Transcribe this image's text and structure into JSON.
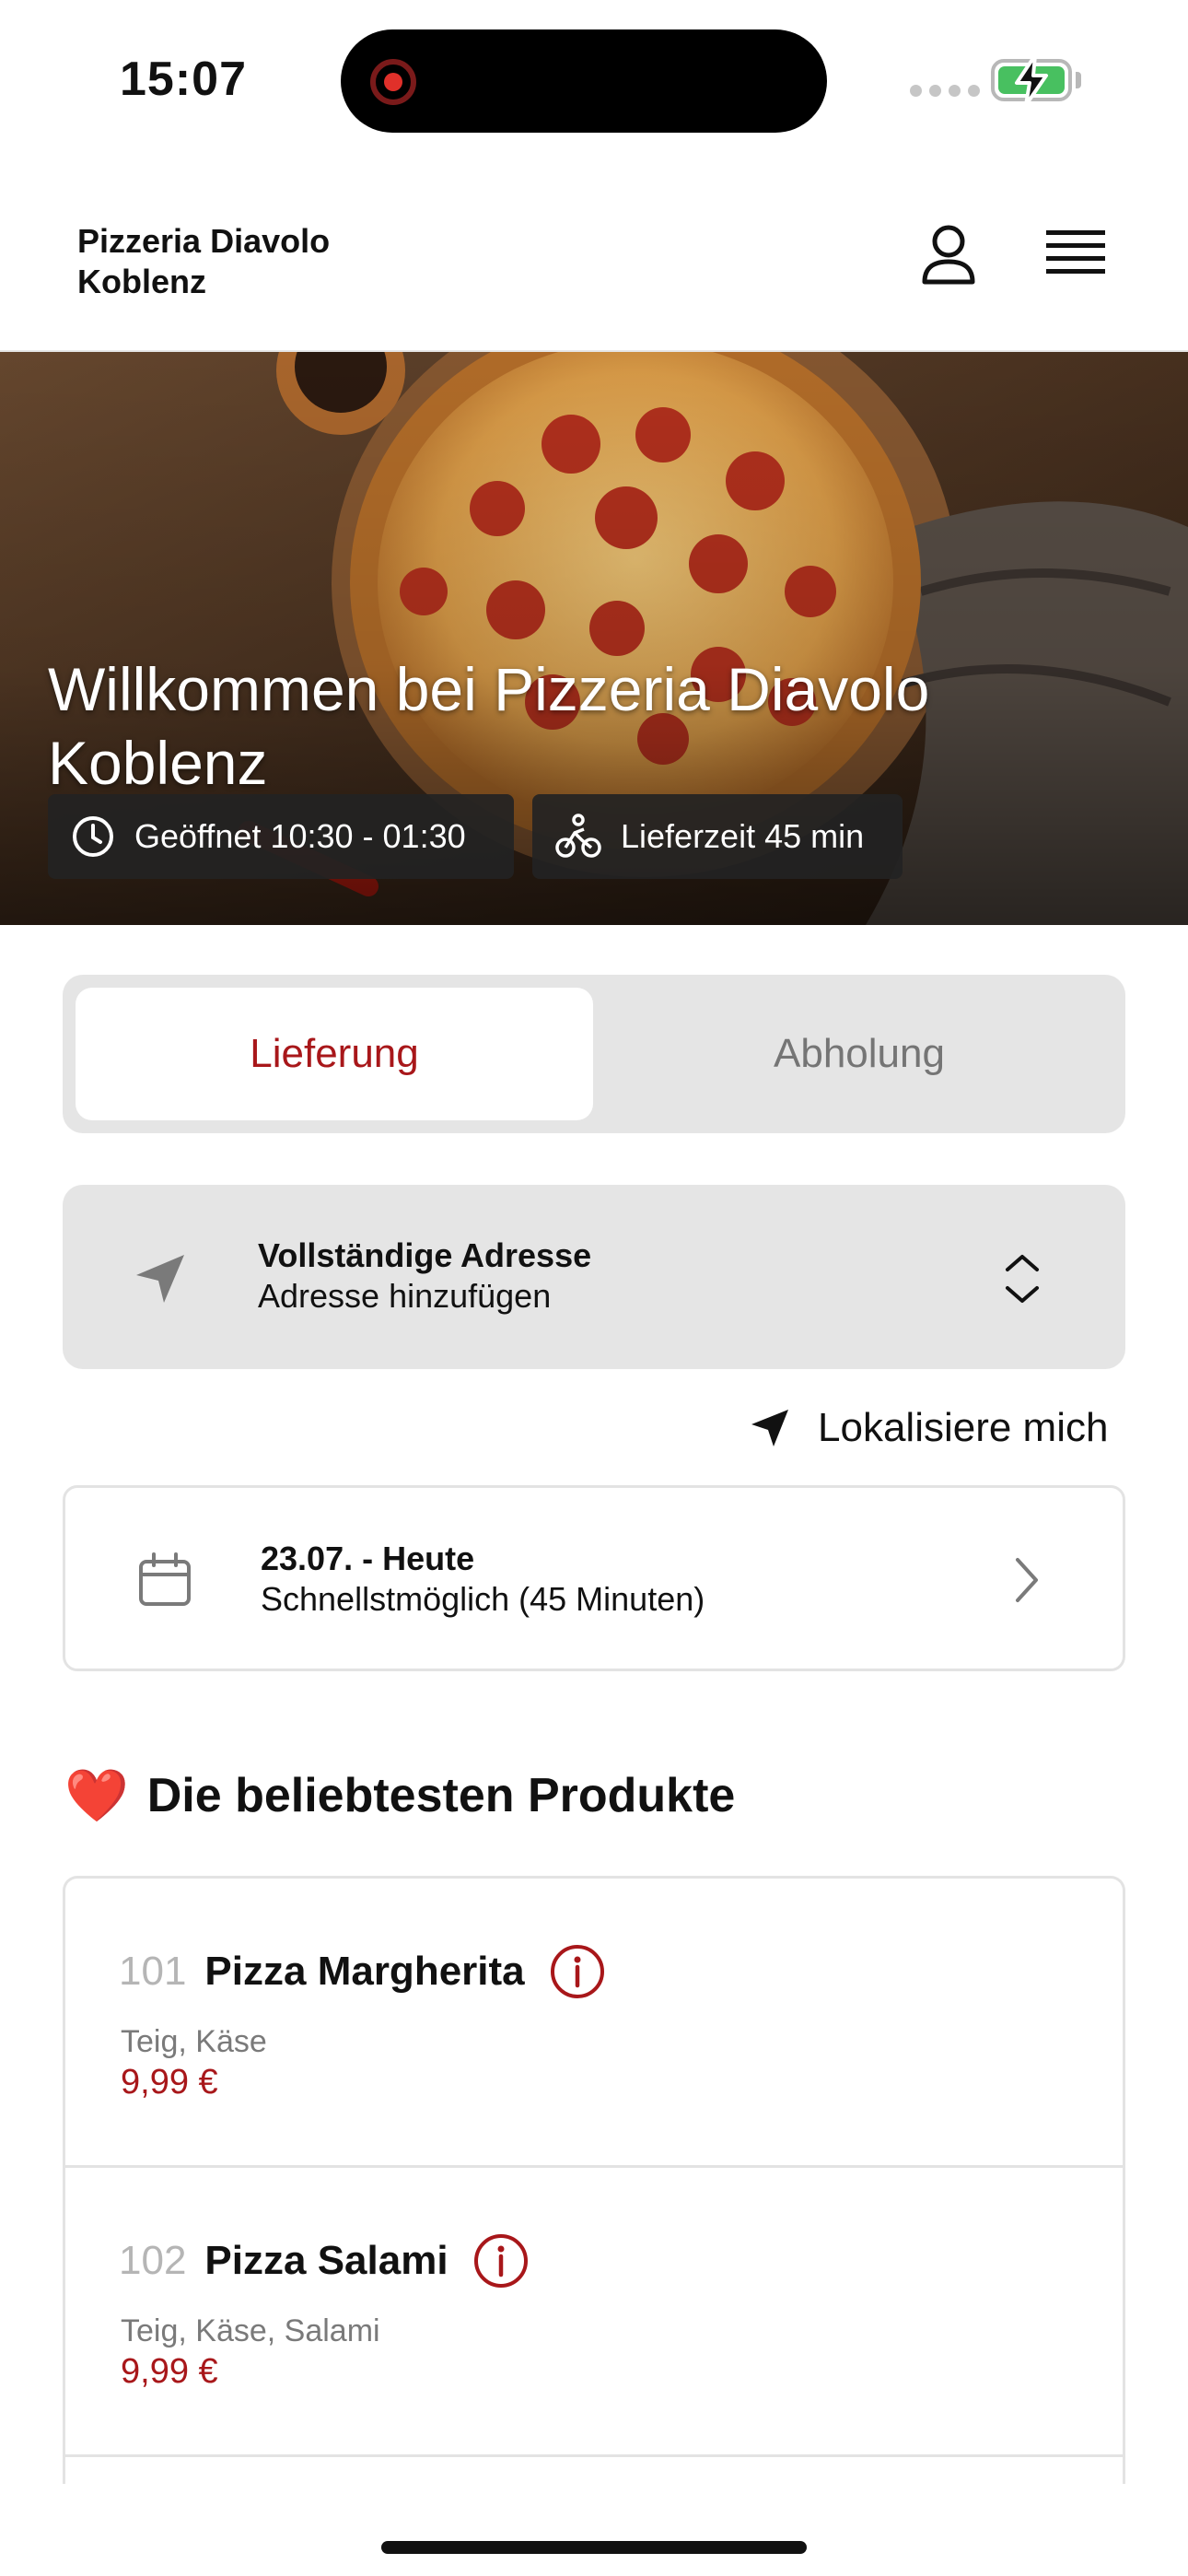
{
  "status_bar": {
    "time": "15:07"
  },
  "header": {
    "brand_line1": "Pizzeria Diavolo",
    "brand_line2": "Koblenz",
    "user_icon": "user-icon",
    "menu_icon": "hamburger-menu-icon"
  },
  "hero": {
    "title": "Willkommen bei Pizzeria Diavolo Koblenz",
    "opening_hours": "Geöffnet 10:30 - 01:30",
    "delivery_time": "Lieferzeit 45 min"
  },
  "order_mode": {
    "active": "Lieferung",
    "inactive": "Abholung"
  },
  "address": {
    "title": "Vollständige Adresse",
    "subtitle": "Adresse hinzufügen"
  },
  "locate_me": "Lokalisiere mich",
  "date": {
    "title": "23.07. - Heute",
    "subtitle": "Schnellstmöglich (45 Minuten)"
  },
  "popular": {
    "emoji": "❤️",
    "title": "Die beliebtesten Produkte",
    "items": [
      {
        "number": "101",
        "name": "Pizza Margherita",
        "ingredients": "Teig, Käse",
        "price": "9,99 €"
      },
      {
        "number": "102",
        "name": "Pizza Salami",
        "ingredients": "Teig, Käse, Salami",
        "price": "9,99 €"
      }
    ]
  },
  "colors": {
    "accent": "#a8171a",
    "badge_bg": "#232323",
    "segment_bg": "#e5e5e5",
    "battery": "#48c060"
  }
}
